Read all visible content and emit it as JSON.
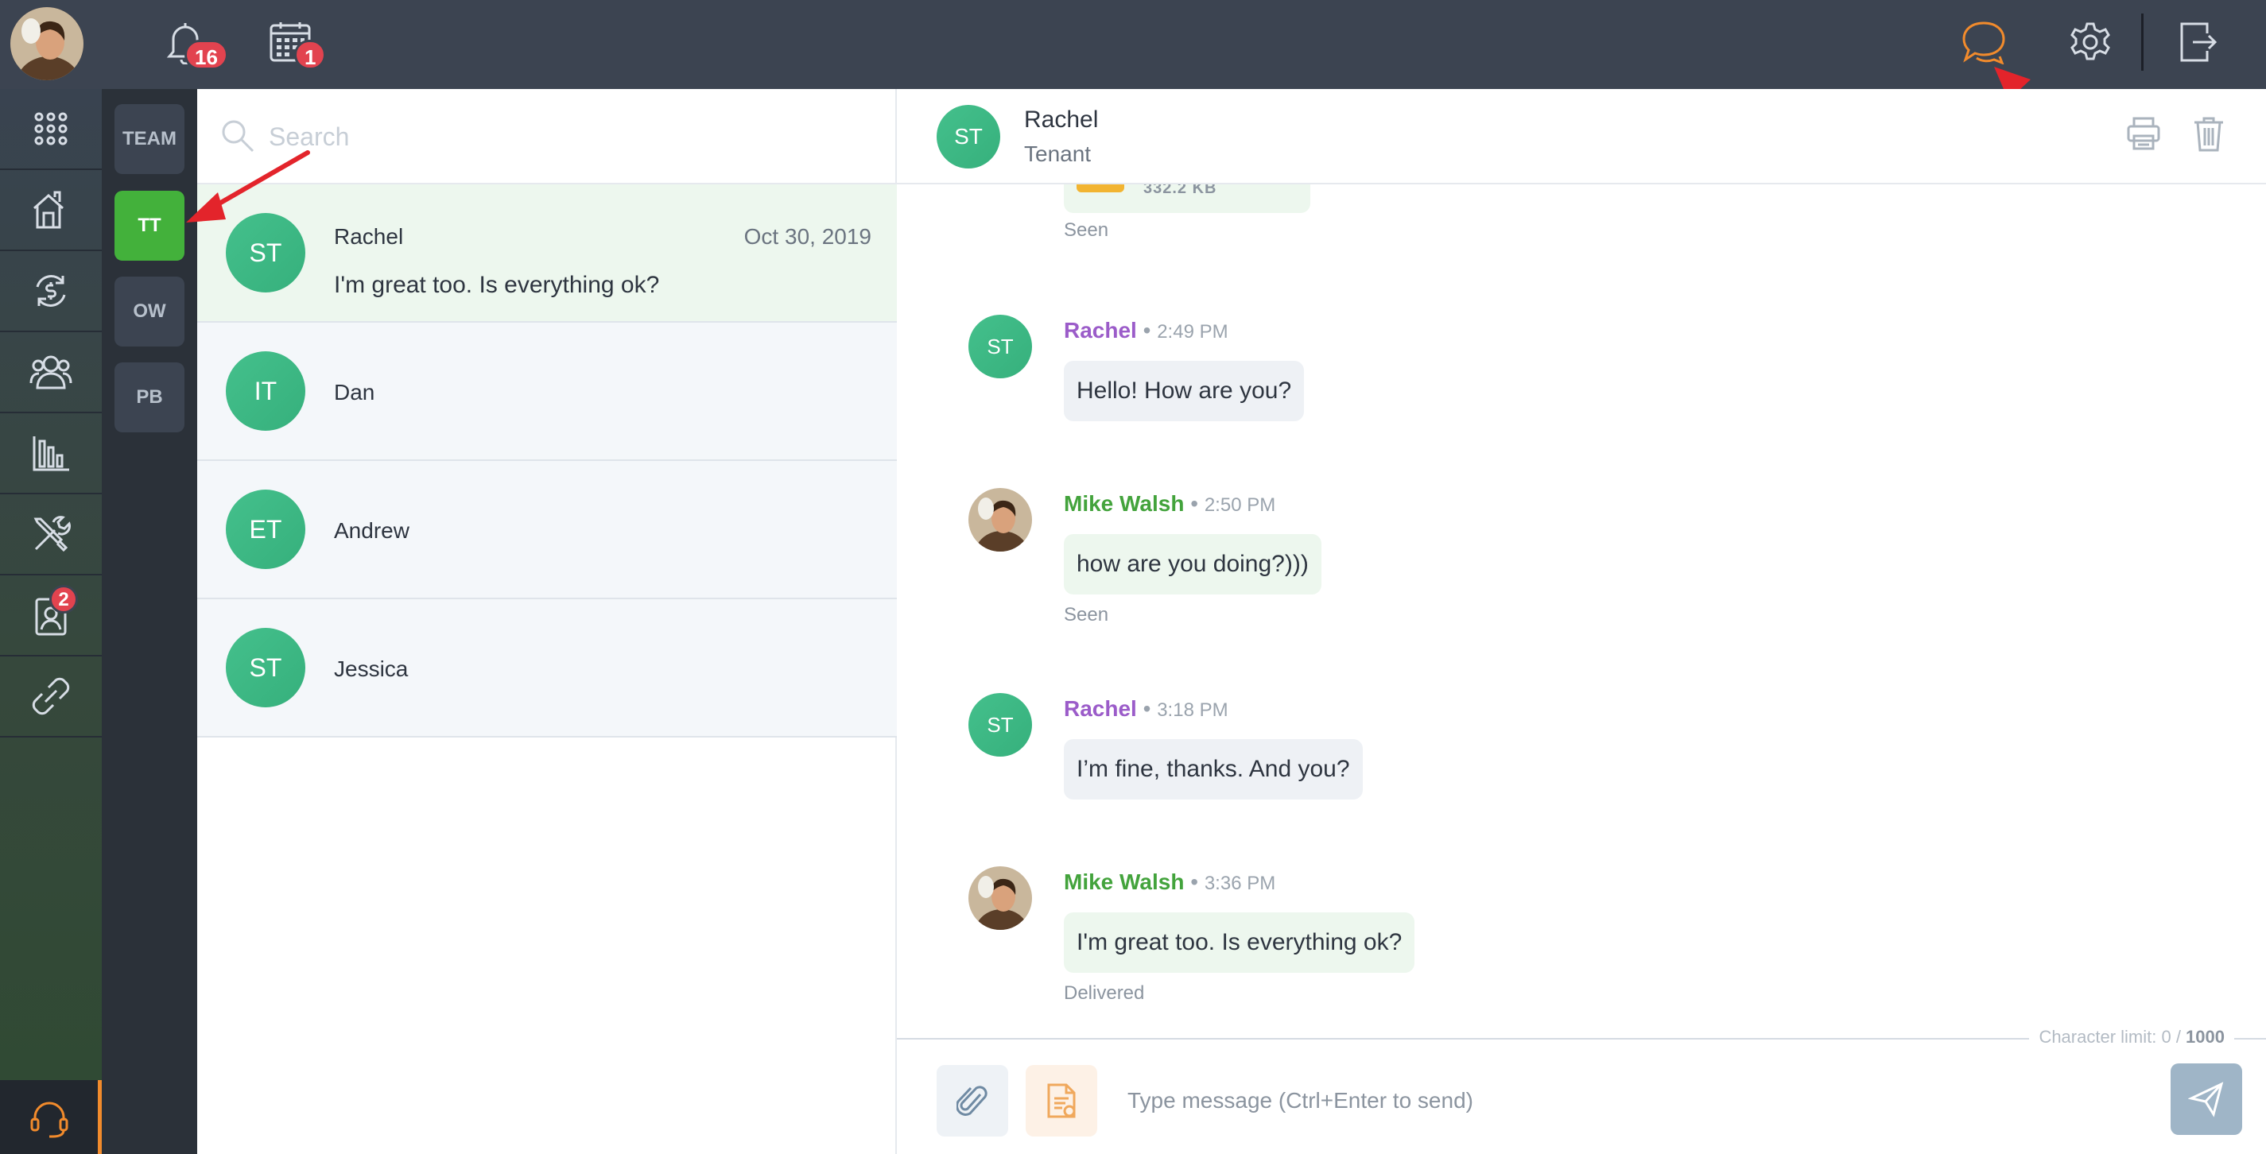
{
  "topbar": {
    "notifications_count": "16",
    "calendar_count": "1",
    "accent_color": "#f28b2c",
    "icons": [
      "bell-icon",
      "calendar-icon",
      "chat-icon",
      "gear-icon",
      "logout-icon"
    ]
  },
  "sidebar": {
    "items": [
      {
        "icon": "apps-grid-icon"
      },
      {
        "icon": "properties-icon"
      },
      {
        "icon": "accounting-icon"
      },
      {
        "icon": "people-icon"
      },
      {
        "icon": "reports-icon"
      },
      {
        "icon": "maintenance-icon"
      },
      {
        "icon": "applicants-icon",
        "badge": "2"
      },
      {
        "icon": "links-icon"
      }
    ],
    "support_icon": "headset-icon"
  },
  "filters": [
    {
      "label": "TEAM",
      "active": false
    },
    {
      "label": "TT",
      "active": true
    },
    {
      "label": "OW",
      "active": false
    },
    {
      "label": "PB",
      "active": false
    }
  ],
  "search": {
    "placeholder": "Search"
  },
  "conversations": [
    {
      "initials": "ST",
      "name": "Rachel",
      "date": "Oct 30, 2019",
      "preview": "I'm great too. Is everything ok?",
      "active": true
    },
    {
      "initials": "IT",
      "name": "Dan",
      "date": "",
      "preview": "",
      "active": false
    },
    {
      "initials": "ET",
      "name": "Andrew",
      "date": "",
      "preview": "",
      "active": false
    },
    {
      "initials": "ST",
      "name": "Jessica",
      "date": "",
      "preview": "",
      "active": false
    }
  ],
  "chat": {
    "contact_initials": "ST",
    "contact_name": "Rachel",
    "contact_role": "Tenant",
    "file_size": "332.2 KB",
    "file_status": "Seen",
    "messages": [
      {
        "author": "Rachel",
        "time": "2:49 PM",
        "text": "Hello! How are you?",
        "initials": "ST",
        "status": ""
      },
      {
        "author": "Mike Walsh",
        "time": "2:50 PM",
        "text": "how are you doing?)))",
        "initials": "",
        "status": "Seen"
      },
      {
        "author": "Rachel",
        "time": "3:18 PM",
        "text": "I’m fine, thanks. And you?",
        "initials": "ST",
        "status": ""
      },
      {
        "author": "Mike Walsh",
        "time": "3:36 PM",
        "text": "I'm great too. Is everything ok?",
        "initials": "",
        "status": "Delivered"
      }
    ],
    "separator": "•"
  },
  "composer": {
    "char_limit_label": "Character limit: 0 / ",
    "char_limit_max": "1000",
    "placeholder": "Type message (Ctrl+Enter to send)"
  }
}
